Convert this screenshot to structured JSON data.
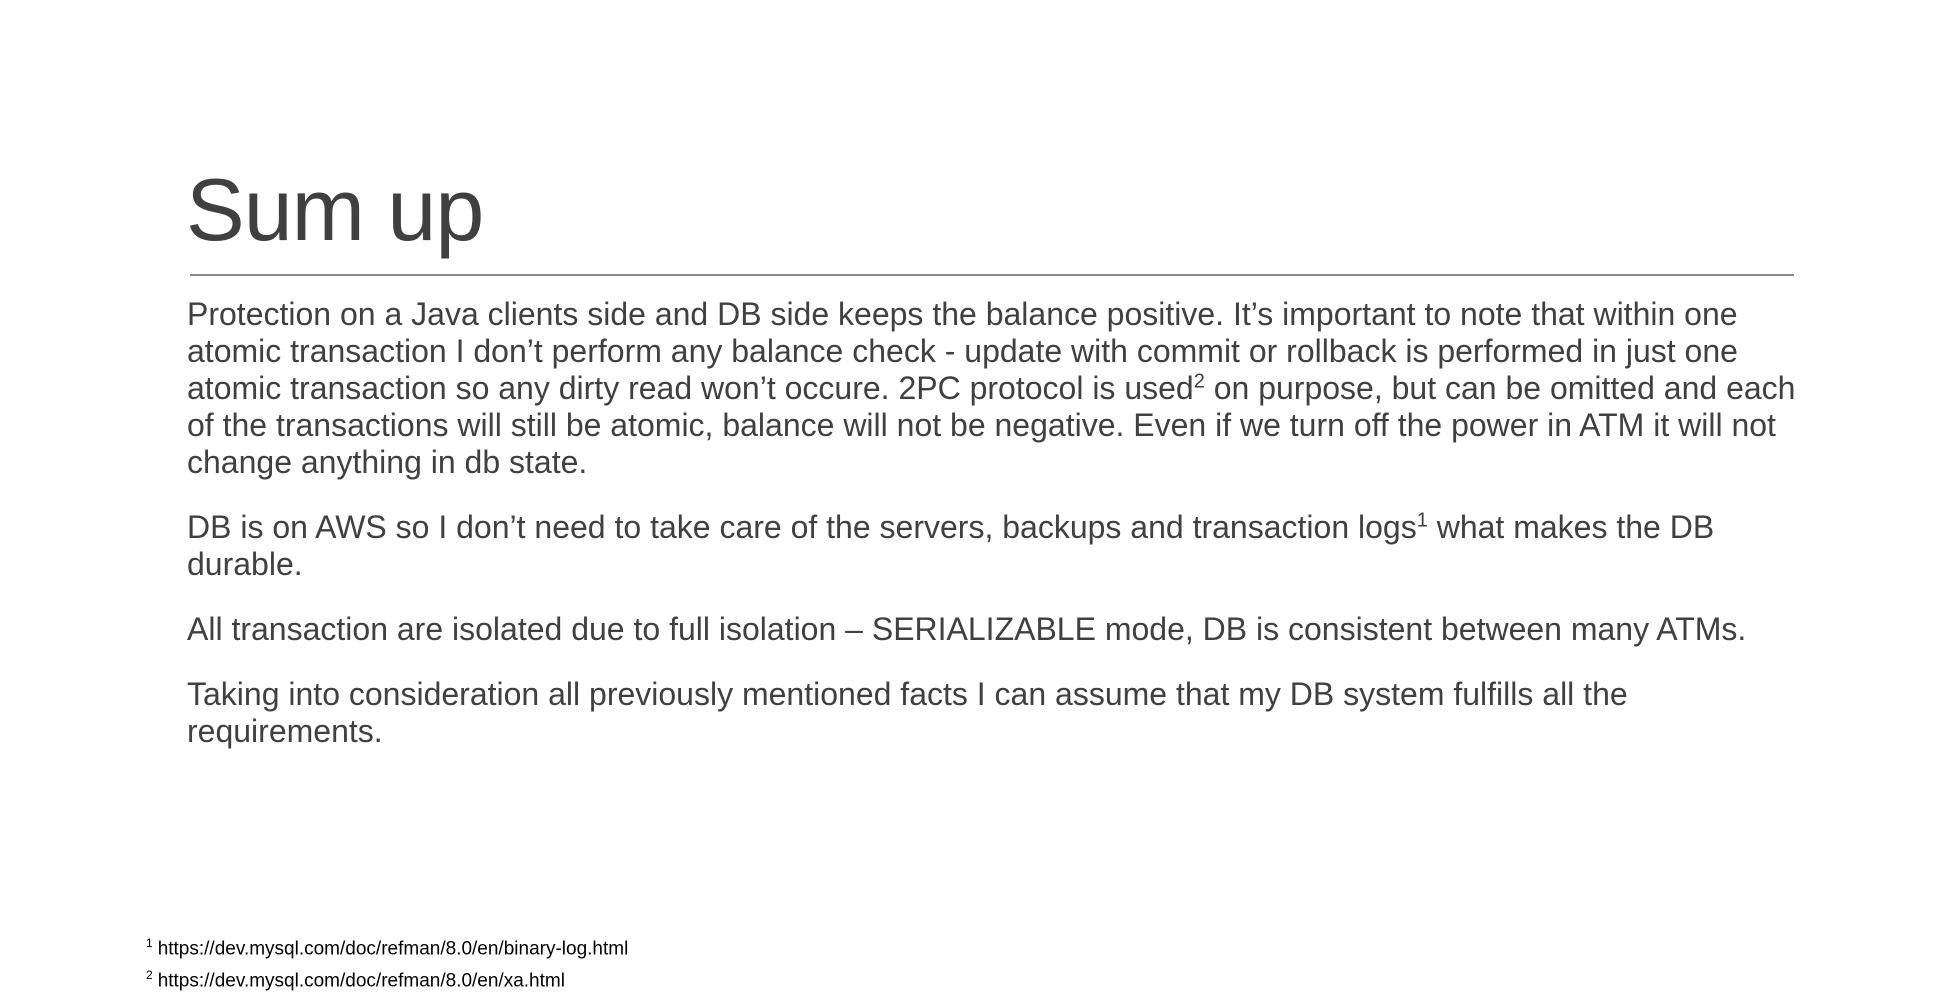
{
  "title": "Sum up",
  "paragraphs": [
    {
      "before": "Protection on a Java clients side and DB side keeps the balance positive. It’s important to note that within one atomic transaction I don’t perform any balance check - update with commit or rollback is performed in just one atomic transaction so any dirty read won’t occure. 2PC protocol is used",
      "sup": "2",
      "after": " on purpose, but can be omitted and each of the transactions will still be atomic, balance will not be negative. Even if we turn off the power in ATM it will not change anything in db state."
    },
    {
      "before": "DB is on AWS so I don’t need to take care of the servers, backups and transaction logs",
      "sup": "1",
      "after": " what makes the DB durable."
    },
    {
      "before": "All transaction are isolated due to full isolation – SERIALIZABLE mode, DB is consistent between many ATMs.",
      "sup": "",
      "after": ""
    },
    {
      "before": "Taking into consideration all previously mentioned facts I can assume that my DB system fulfills all the requirements.",
      "sup": "",
      "after": ""
    }
  ],
  "footnotes": [
    {
      "mark": "1",
      "text": "https://dev.mysql.com/doc/refman/8.0/en/binary-log.html"
    },
    {
      "mark": "2",
      "text": "https://dev.mysql.com/doc/refman/8.0/en/xa.html"
    }
  ]
}
